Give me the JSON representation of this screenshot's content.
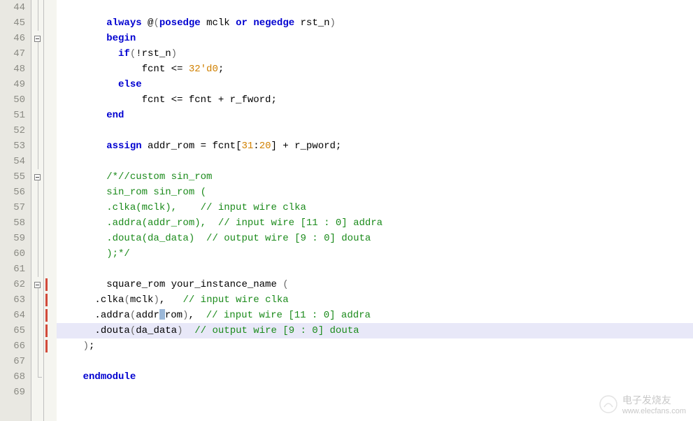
{
  "lines": {
    "start": 44,
    "end": 69
  },
  "code": {
    "l44": "",
    "l45_kw1": "always",
    "l45_t1": " @",
    "l45_p1": "(",
    "l45_kw2": "posedge",
    "l45_t2": " mclk ",
    "l45_kw3": "or",
    "l45_t3": " ",
    "l45_kw4": "negedge",
    "l45_t4": " rst_n",
    "l45_p2": ")",
    "l46_kw": "begin",
    "l47_kw": "if",
    "l47_p1": "(",
    "l47_t": "!rst_n",
    "l47_p2": ")",
    "l48_t1": "fcnt <= ",
    "l48_num": "32'd0",
    "l48_t2": ";",
    "l49_kw": "else",
    "l50_t": "fcnt <= fcnt + r_fword;",
    "l51_kw": "end",
    "l52": "",
    "l53_kw": "assign",
    "l53_t1": " addr_rom = fcnt[",
    "l53_n1": "31",
    "l53_t2": ":",
    "l53_n2": "20",
    "l53_t3": "] + r_pword;",
    "l54": "",
    "l55_c": "/*//custom sin_rom",
    "l56_c": "sin_rom sin_rom (",
    "l57_c": ".clka(mclk),    // input wire clka",
    "l58_c": ".addra(addr_rom),  // input wire [11 : 0] addra",
    "l59_c": ".douta(da_data)  // output wire [9 : 0] douta",
    "l60_c": ");*/",
    "l61": "",
    "l62_t": " square_rom your_instance_name ",
    "l62_p": "(",
    "l63_t1": ".clka",
    "l63_p1": "(",
    "l63_t2": "mclk",
    "l63_p2": ")",
    "l63_t3": ",   ",
    "l63_c": "// input wire clka",
    "l64_t1": ".addra",
    "l64_p1": "(",
    "l64_t2a": "addr",
    "l64_t2b": "rom",
    "l64_p2": ")",
    "l64_t3": ",  ",
    "l64_c": "// input wire [11 : 0] addra",
    "l65_t1": ".douta",
    "l65_p1": "(",
    "l65_t2": "da_data",
    "l65_p2": ")",
    "l65_t3": "  ",
    "l65_c": "// output wire [9 : 0] douta",
    "l66_p": ")",
    "l66_t": ";",
    "l67": "",
    "l68_kw": "endmodule",
    "l69": ""
  },
  "watermark": {
    "title": "电子发烧友",
    "url": "www.elecfans.com"
  }
}
